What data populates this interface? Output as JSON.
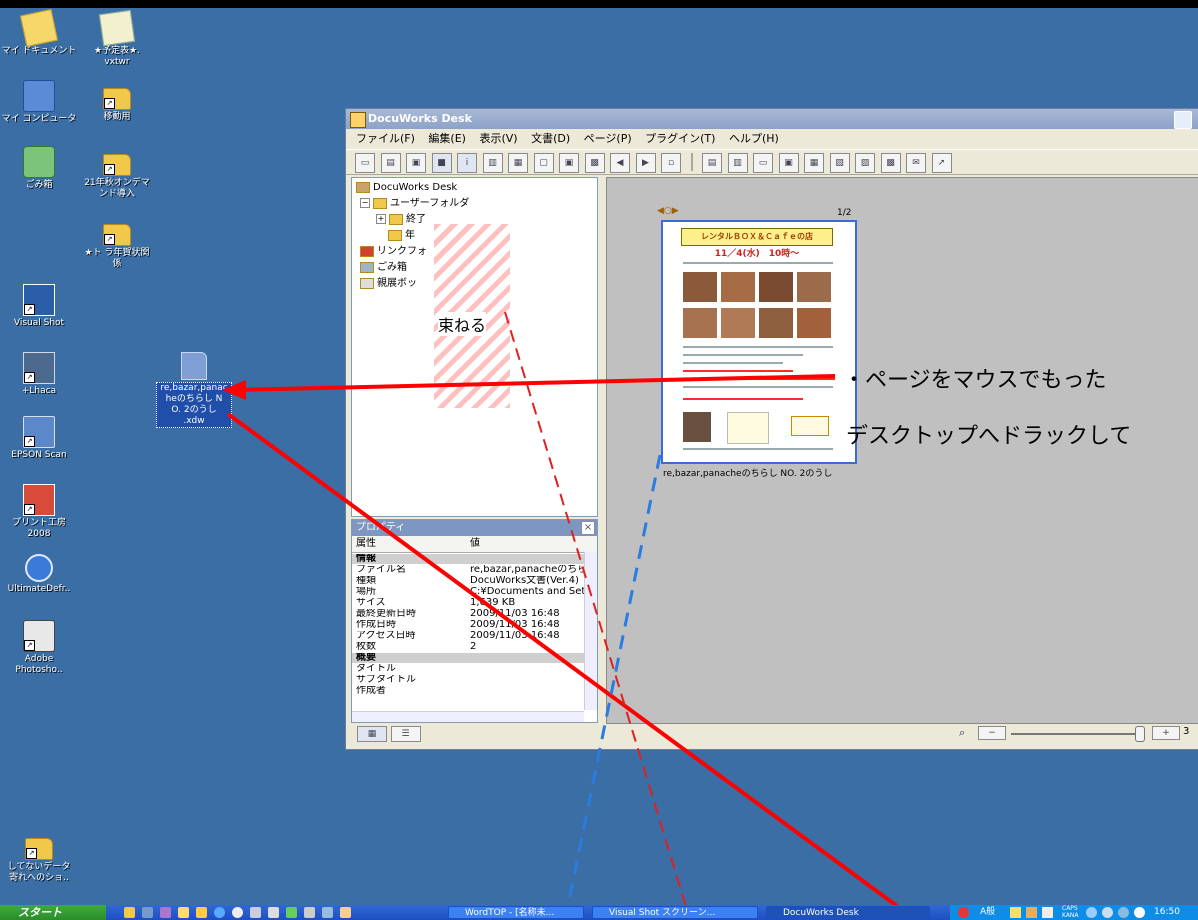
{
  "desktop": {
    "icons": [
      {
        "label": "マイ ドキュメント",
        "icon": "my-documents-icon"
      },
      {
        "label": "★予定表★.\nvxtwr",
        "icon": "notepad-icon"
      },
      {
        "label": "マイ コンピュータ",
        "icon": "my-computer-icon"
      },
      {
        "label": "移動用",
        "icon": "folder-icon"
      },
      {
        "label": "ごみ箱",
        "icon": "recycle-bin-icon"
      },
      {
        "label": "21年秋オンデマ\nンド導入",
        "icon": "folder-icon"
      },
      {
        "label": "★ト ラ年賀状関\n係",
        "icon": "folder-icon"
      },
      {
        "label": "Visual Shot",
        "icon": "visual-shot-icon"
      },
      {
        "label": "+Lhaca",
        "icon": "lhaca-icon"
      },
      {
        "label": "re,bazar,panac\nheのちらし N\nO. 2のうし\n.xdw",
        "icon": "docuworks-file-icon"
      },
      {
        "label": "EPSON Scan",
        "icon": "scanner-icon"
      },
      {
        "label": "プリント工房\n2008",
        "icon": "print-studio-icon"
      },
      {
        "label": "UltimateDefr..",
        "icon": "defrag-icon"
      },
      {
        "label": "Adobe\nPhotosho..",
        "icon": "photoshop-icon"
      },
      {
        "label": "してないデータ\n寄れへのショ..",
        "icon": "folder-icon"
      }
    ]
  },
  "window": {
    "title": "DocuWorks Desk",
    "menu": [
      "ファイル(F)",
      "編集(E)",
      "表示(V)",
      "文書(D)",
      "ページ(P)",
      "プラグイン(T)",
      "ヘルプ(H)"
    ],
    "tree": {
      "root": "DocuWorks Desk",
      "user_folder": "ユーザーフォルダ",
      "item_done": "終了",
      "item_year": "年",
      "link_folder": "リンクフォ",
      "trash": "ごみ箱",
      "exhibit": "親展ボッ"
    },
    "hatch_label": "束ねる",
    "properties": {
      "title": "プロパティ",
      "col_attr": "属性",
      "col_value": "値",
      "rows": [
        {
          "k": "情報",
          "v": "",
          "group": true
        },
        {
          "k": "ファイル名",
          "v": "re,bazar,panacheのちらし"
        },
        {
          "k": "種類",
          "v": "DocuWorks文書(Ver.4)"
        },
        {
          "k": "場所",
          "v": "C:¥Documents and Set"
        },
        {
          "k": "サイズ",
          "v": "1,639 KB"
        },
        {
          "k": "最終更新日時",
          "v": "2009/11/03 16:48"
        },
        {
          "k": "作成日時",
          "v": "2009/11/03 16:48"
        },
        {
          "k": "アクセス日時",
          "v": "2009/11/03 16:48"
        },
        {
          "k": "枚数",
          "v": "2"
        },
        {
          "k": "概要",
          "v": "",
          "group": true
        },
        {
          "k": "タイトル",
          "v": ""
        },
        {
          "k": "サブタイトル",
          "v": ""
        },
        {
          "k": "作成者",
          "v": ""
        }
      ]
    },
    "document": {
      "page_indicator": "1/2",
      "flyer_title": "レンタルＢＯＸ＆Ｃａｆｅの店",
      "flyer_date": "11／4(水)　10時～",
      "caption": "re,bazar,panacheのちらし NO. 2のうし"
    },
    "zoom_value": "3"
  },
  "annotations": {
    "line1": "・ページをマウスでもった",
    "line2": "デスクトップへドラックして"
  },
  "taskbar": {
    "start_label": "スタート",
    "tasks": [
      "WordTOP - [名称未...",
      "Visual Shot スクリーン...",
      "DocuWorks Desk"
    ],
    "ime": "A般",
    "caps": "CAPS\nKANA",
    "clock": "16:50"
  },
  "colors": {
    "desktop": "#3a6ea5",
    "taskbar": "#245edb",
    "arrow": "#ff0000",
    "red_dash": "#e02020",
    "blue_dash": "#2a7de0"
  }
}
